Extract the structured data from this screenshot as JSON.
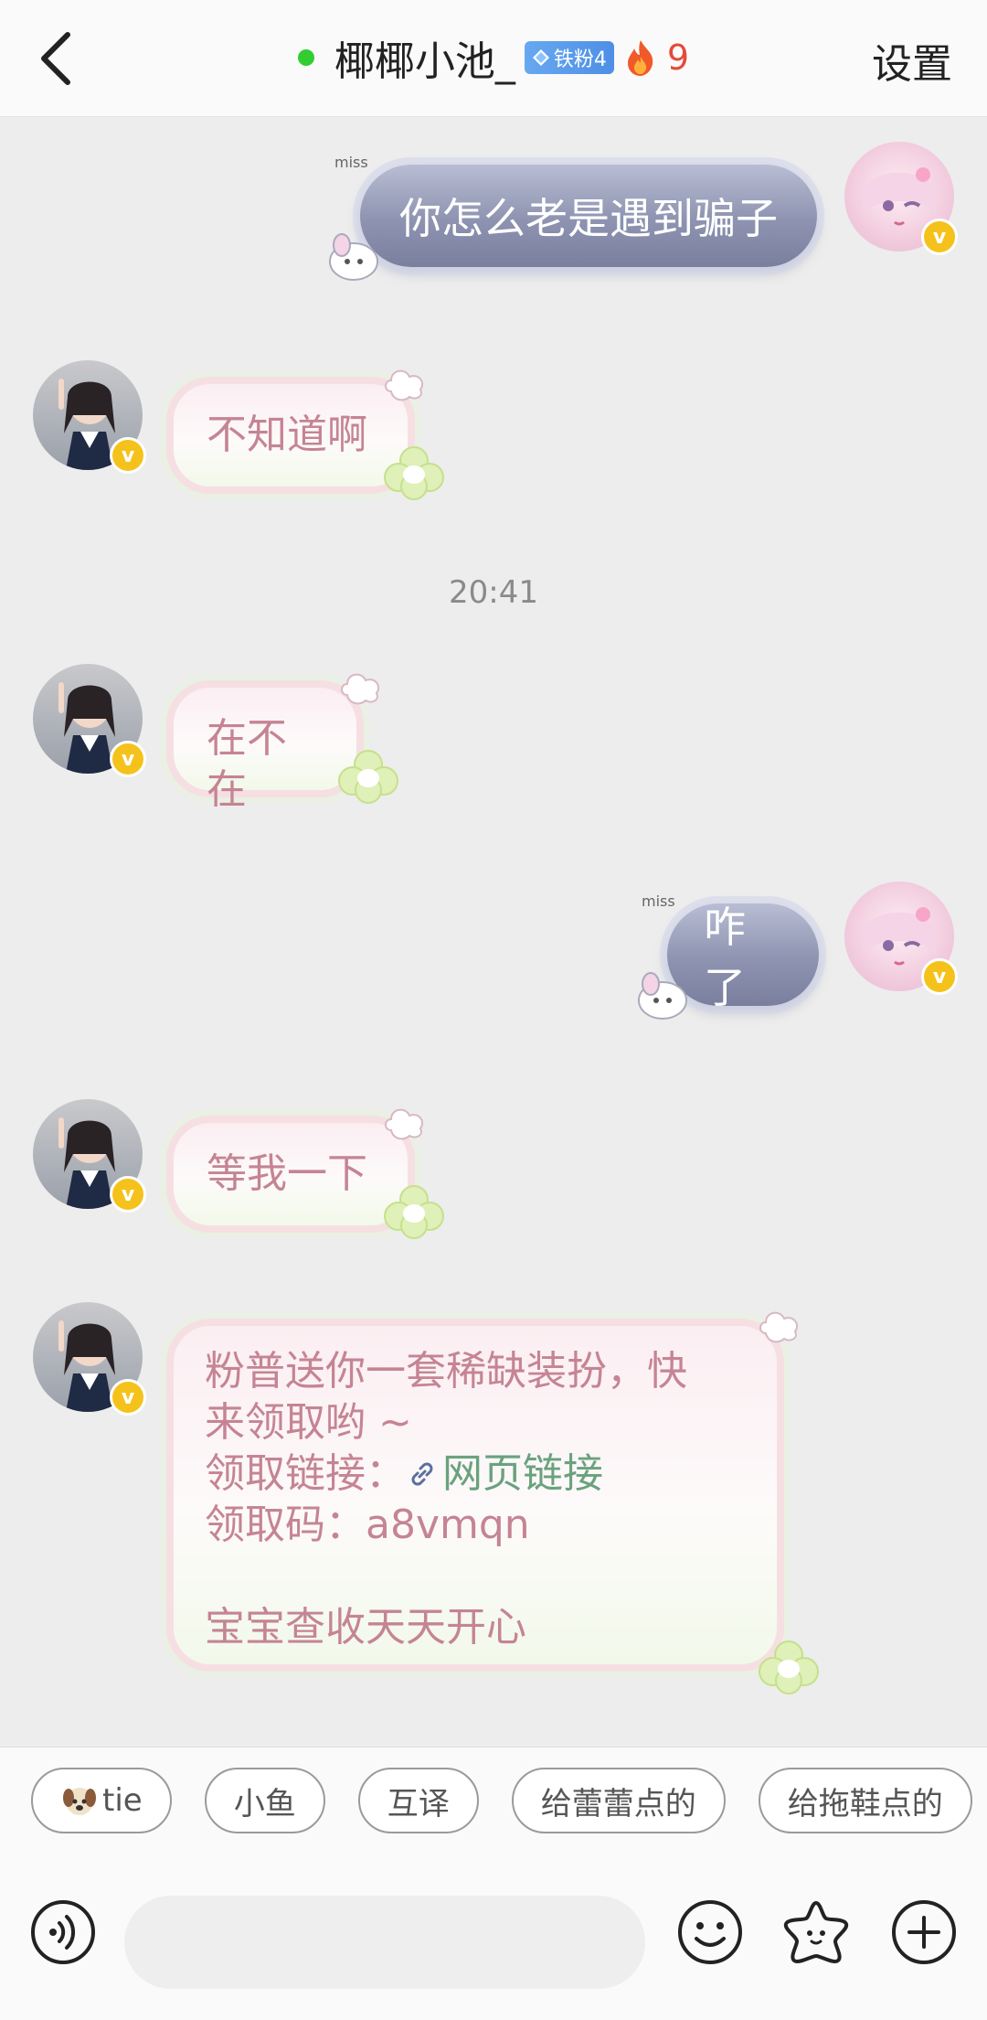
{
  "header": {
    "title": "椰椰小池_",
    "fan_badge": "铁粉4",
    "streak": "9",
    "settings_label": "设置"
  },
  "messages": [
    {
      "side": "out",
      "text": "你怎么老是遇到骗子"
    },
    {
      "side": "in",
      "text": "不知道啊"
    },
    {
      "side": "in",
      "text": "在不在"
    },
    {
      "side": "out",
      "text": "咋了"
    },
    {
      "side": "in",
      "text": "等我一下"
    },
    {
      "side": "in",
      "line1": "粉普送你一套稀缺装扮，快",
      "line2": "来领取哟 ~",
      "line3_prefix": "领取链接：",
      "link_text": "网页链接",
      "line4": "领取码：a8vmqn",
      "line6": "宝宝查收天天开心"
    }
  ],
  "timestamp": "20:41",
  "sticker_text": "miss",
  "quick_replies": [
    "tie",
    "小鱼",
    "互译",
    "给蕾蕾点的",
    "给拖鞋点的"
  ],
  "input": {
    "placeholder": ""
  },
  "icons": [
    "back-chevron-icon",
    "diamond-icon",
    "flame-icon",
    "voice-icon",
    "emoji-icon",
    "sticker-icon",
    "plus-icon"
  ],
  "colors": {
    "bubble_out": "#8d93b0",
    "bubble_in_text": "#c58494",
    "link": "#6aa27d",
    "badge": "#f5c21c",
    "streak": "#e54a3a"
  }
}
